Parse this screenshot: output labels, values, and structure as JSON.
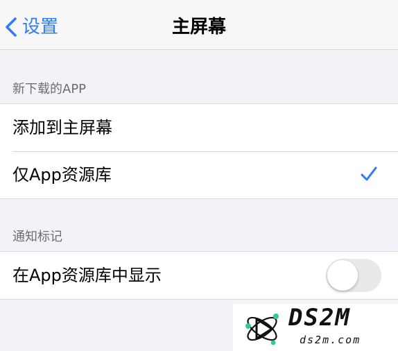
{
  "nav": {
    "back_label": "设置",
    "title": "主屏幕"
  },
  "sections": {
    "new_apps": {
      "header": "新下载的APP",
      "options": [
        {
          "label": "添加到主屏幕",
          "selected": false
        },
        {
          "label": "仅App资源库",
          "selected": true
        }
      ]
    },
    "badges": {
      "header": "通知标记",
      "label": "在App资源库中显示",
      "enabled": false
    }
  },
  "watermark": {
    "title": "DS2M",
    "subtitle": "ds2m.com"
  },
  "colors": {
    "accent": "#2f7cf6",
    "background": "#f2f2f7",
    "toggle_off": "#e9e9eb"
  },
  "icons": [
    "chevron-left-icon",
    "checkmark-icon",
    "ds2m-logo-icon"
  ]
}
